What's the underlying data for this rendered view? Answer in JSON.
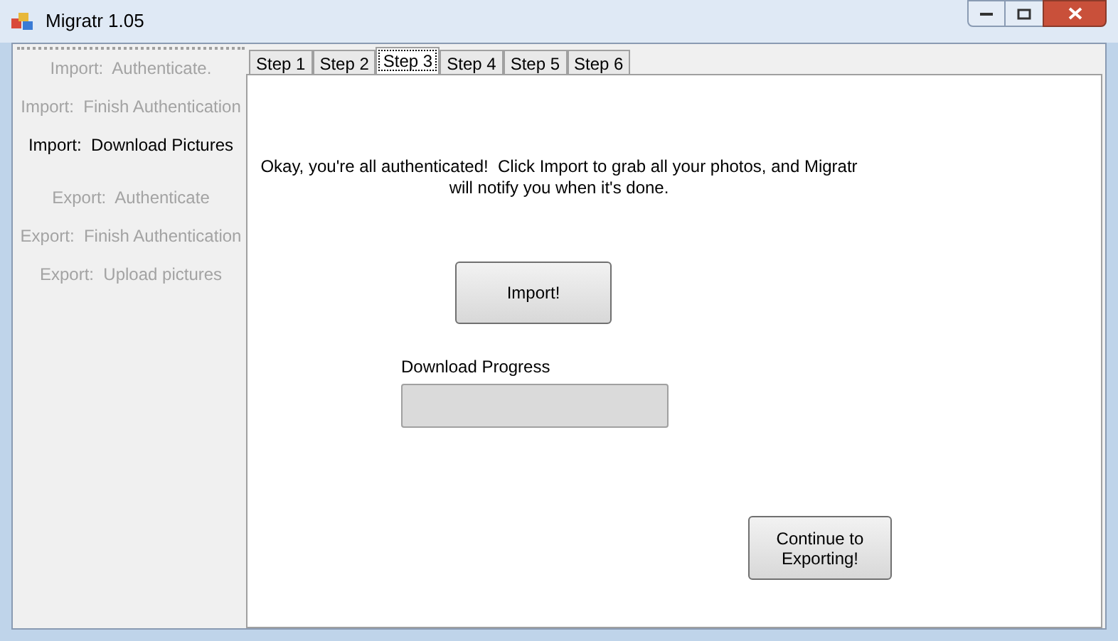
{
  "window": {
    "title": "Migratr 1.05"
  },
  "sidebar": {
    "items": [
      {
        "label": "Import:  Authenticate.",
        "selected": false
      },
      {
        "label": "Import:  Finish Authentication",
        "selected": false
      },
      {
        "label": "Import:  Download Pictures",
        "selected": true
      },
      {
        "label": "Export:  Authenticate",
        "selected": false
      },
      {
        "label": "Export:  Finish Authentication",
        "selected": false
      },
      {
        "label": "Export:  Upload pictures",
        "selected": false
      }
    ]
  },
  "tabs": [
    {
      "label": "Step 1",
      "selected": false
    },
    {
      "label": "Step 2",
      "selected": false
    },
    {
      "label": "Step 3",
      "selected": true
    },
    {
      "label": "Step 4",
      "selected": false
    },
    {
      "label": "Step 5",
      "selected": false
    },
    {
      "label": "Step 6",
      "selected": false
    }
  ],
  "panel": {
    "message": "Okay, you're all authenticated!  Click Import to grab all your photos, and Migratr will notify you when it's done.",
    "import_button": "Import!",
    "progress": {
      "label": "Download Progress"
    },
    "continue_button": "Continue to Exporting!"
  }
}
